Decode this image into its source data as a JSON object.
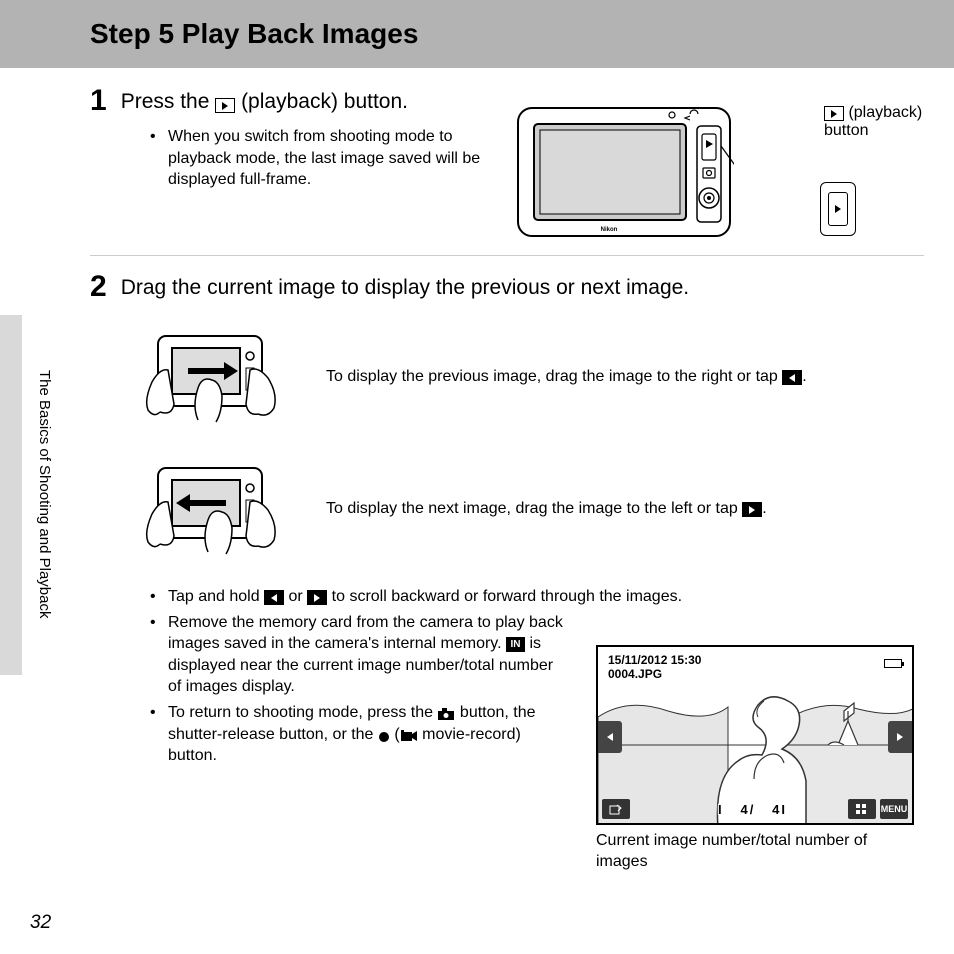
{
  "title": "Step 5 Play Back Images",
  "side_text": "The Basics of Shooting and Playback",
  "page_number": "32",
  "step1": {
    "num": "1",
    "title_before": "Press the ",
    "title_after": " (playback) button.",
    "bullet": "When you switch from shooting mode to playback mode, the last image saved will be displayed full-frame.",
    "callout_before": " (playback)",
    "callout_after": "button"
  },
  "step2": {
    "num": "2",
    "title": "Drag the current image to display the previous or next image.",
    "drag_prev": "To display the previous image, drag the image to the right or tap ",
    "drag_next": "To display the next image, drag the image to the left or tap ",
    "b1_before": "Tap and hold ",
    "b1_mid": " or ",
    "b1_after": " to scroll backward or forward through the images.",
    "b2_before": "Remove the memory card from the camera to play back images saved in the camera's internal memory. ",
    "b2_after": " is displayed near the current image number/total number of images display.",
    "b3_before": "To return to shooting mode, press the ",
    "b3_mid": " button, the shutter-release button, or the ",
    "b3_after": " movie-record) button."
  },
  "screen": {
    "datetime": "15/11/2012  15:30",
    "filename": "0004.JPG",
    "counter_prefix": "I",
    "counter_cur": "4/",
    "counter_total": "4I",
    "menu": "MENU",
    "caption": "Current image number/total number of images"
  }
}
